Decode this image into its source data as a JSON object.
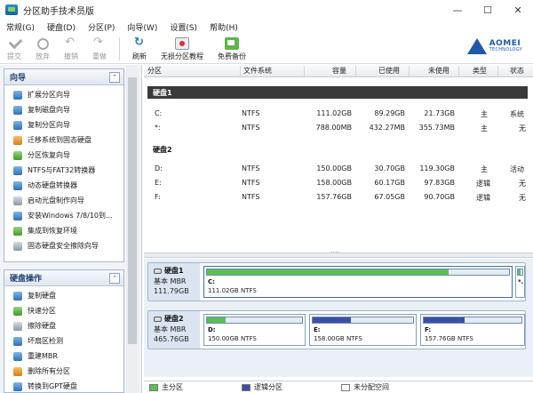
{
  "window": {
    "title": "分区助手技术员版",
    "controls": [
      "—",
      "☐",
      "✕"
    ]
  },
  "menu": [
    "常规(G)",
    "硬盘(D)",
    "分区(P)",
    "向导(W)",
    "设置(S)",
    "帮助(H)"
  ],
  "toolbar": {
    "commit": "提交",
    "discard": "放弃",
    "undo": "撤销",
    "redo": "重做",
    "refresh": "刷新",
    "tutorial": "无损分区教程",
    "backup": "免费备份"
  },
  "logo": {
    "brand": "AOMEI",
    "sub": "TECHNOLOGY"
  },
  "wizard_panel": {
    "title": "向导",
    "items": [
      "扩展分区向导",
      "复制磁盘向导",
      "复制分区向导",
      "迁移系统到固态硬盘",
      "分区恢复向导",
      "NTFS与FAT32转换器",
      "动态硬盘转换器",
      "启动光盘制作向导",
      "安装Windows 7/8/10到...",
      "集成到恢复环境",
      "固态硬盘安全擦除向导"
    ]
  },
  "disk_ops_panel": {
    "title": "硬盘操作",
    "items": [
      "复制硬盘",
      "快速分区",
      "擦除硬盘",
      "坏扇区检测",
      "重建MBR",
      "删除所有分区",
      "转换到GPT硬盘"
    ]
  },
  "table": {
    "columns": [
      "分区",
      "文件系统",
      "容量",
      "已使用",
      "未使用",
      "类型",
      "状态"
    ],
    "disks": [
      {
        "label": "硬盘1",
        "partitions": [
          {
            "name": "C:",
            "fs": "NTFS",
            "capacity": "111.02GB",
            "used": "89.29GB",
            "free": "21.73GB",
            "type": "主",
            "status": "系统"
          },
          {
            "name": "*:",
            "fs": "NTFS",
            "capacity": "788.00MB",
            "used": "432.27MB",
            "free": "355.73MB",
            "type": "主",
            "status": "无"
          }
        ]
      },
      {
        "label": "硬盘2",
        "partitions": [
          {
            "name": "D:",
            "fs": "NTFS",
            "capacity": "150.00GB",
            "used": "30.70GB",
            "free": "119.30GB",
            "type": "主",
            "status": "活动"
          },
          {
            "name": "E:",
            "fs": "NTFS",
            "capacity": "158.00GB",
            "used": "60.17GB",
            "free": "97.83GB",
            "type": "逻辑",
            "status": "无"
          },
          {
            "name": "F:",
            "fs": "NTFS",
            "capacity": "157.76GB",
            "used": "67.05GB",
            "free": "90.70GB",
            "type": "逻辑",
            "status": "无"
          }
        ]
      }
    ]
  },
  "map": {
    "disk1": {
      "name": "硬盘1",
      "type": "基本 MBR",
      "size": "111.79GB",
      "parts": [
        {
          "name": "C:",
          "desc": "111.02GB NTFS",
          "used_fraction": 0.8,
          "kind": "primary"
        },
        {
          "name": "*.",
          "desc": "",
          "used_fraction": 0.55,
          "kind": "primary"
        }
      ]
    },
    "disk2": {
      "name": "硬盘2",
      "type": "基本 MBR",
      "size": "465.76GB",
      "parts": [
        {
          "name": "D:",
          "desc": "150.00GB NTFS",
          "used_fraction": 0.2,
          "kind": "primary"
        },
        {
          "name": "E:",
          "desc": "158.00GB NTFS",
          "used_fraction": 0.38,
          "kind": "logical"
        },
        {
          "name": "F:",
          "desc": "157.76GB NTFS",
          "used_fraction": 0.42,
          "kind": "logical"
        }
      ]
    }
  },
  "legend": {
    "primary": "主分区",
    "logical": "逻辑分区",
    "free": "未分配空间"
  }
}
